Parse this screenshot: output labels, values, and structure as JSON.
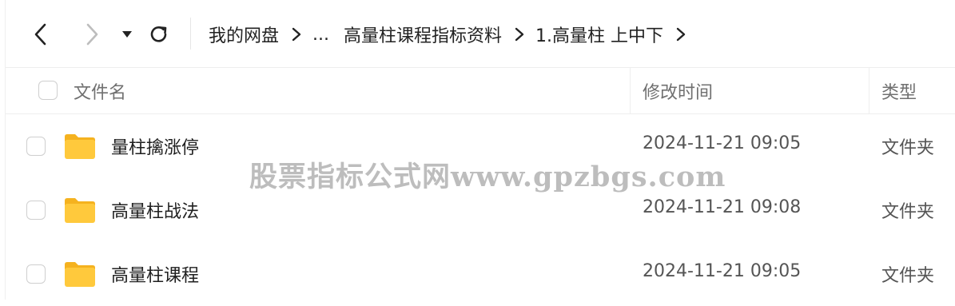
{
  "toolbar": {
    "breadcrumb": [
      "我的网盘",
      "...",
      "高量柱课程指标资料",
      "1.高量柱 上中下"
    ]
  },
  "header": {
    "name_label": "文件名",
    "time_label": "修改时间",
    "type_label": "类型"
  },
  "files": [
    {
      "name": "量柱擒涨停",
      "modified": "2024-11-21 09:05",
      "type": "文件夹"
    },
    {
      "name": "高量柱战法",
      "modified": "2024-11-21 09:08",
      "type": "文件夹"
    },
    {
      "name": "高量柱课程",
      "modified": "2024-11-21 09:05",
      "type": "文件夹"
    }
  ],
  "watermark": "股票指标公式网www.gpzbgs.com",
  "colors": {
    "folder": "#ffc93c",
    "folder_tab": "#f5b21f"
  },
  "icons": {
    "back": "chevron-left-icon",
    "forward": "chevron-right-icon",
    "history": "caret-down-icon",
    "refresh": "refresh-icon",
    "folder": "folder-icon"
  }
}
